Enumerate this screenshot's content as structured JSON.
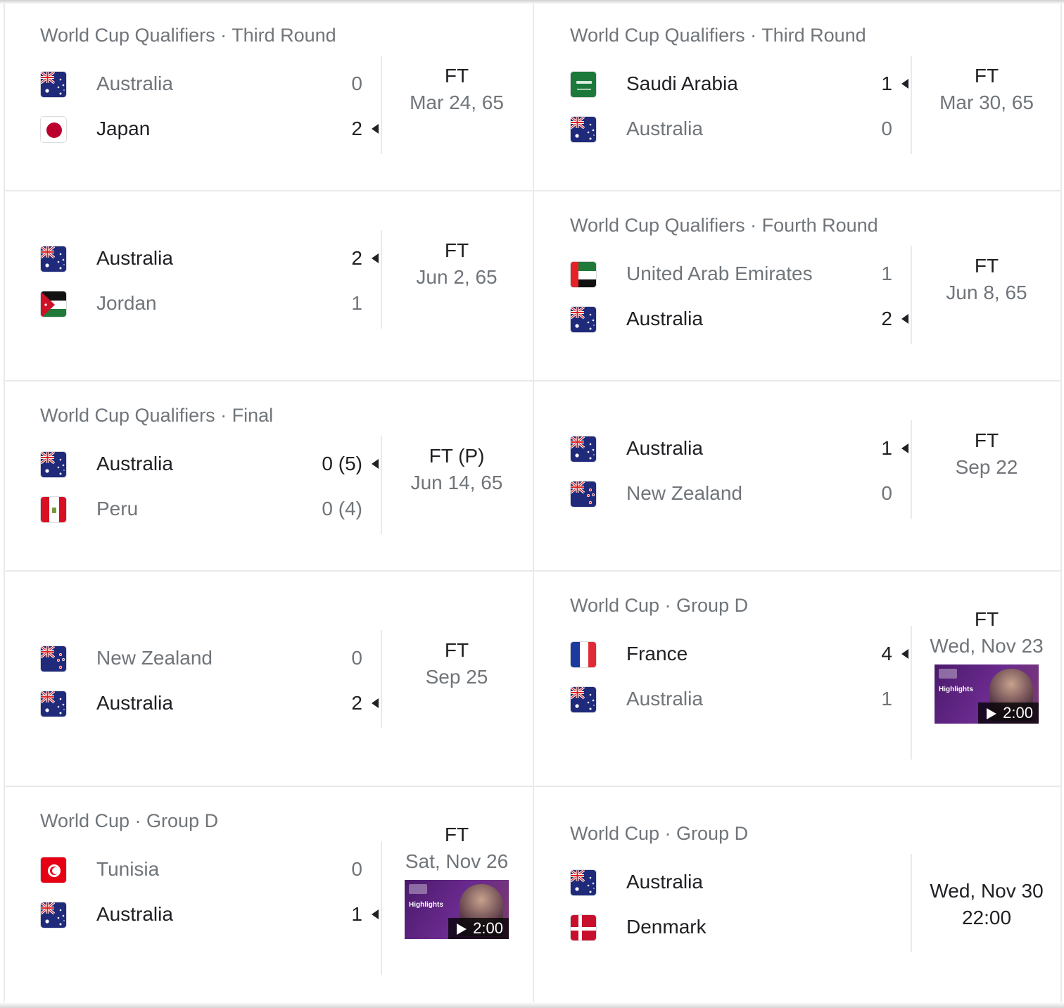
{
  "matches": [
    {
      "competition": "World Cup Qualifiers · Third Round",
      "team1": {
        "name": "Australia",
        "score": "0",
        "flag": "australia",
        "winner": false
      },
      "team2": {
        "name": "Japan",
        "score": "2",
        "flag": "japan",
        "winner": true
      },
      "status": "FT",
      "date": "Mar 24, 65"
    },
    {
      "competition": "World Cup Qualifiers · Third Round",
      "team1": {
        "name": "Saudi Arabia",
        "score": "1",
        "flag": "saudi-arabia",
        "winner": true
      },
      "team2": {
        "name": "Australia",
        "score": "0",
        "flag": "australia",
        "winner": false
      },
      "status": "FT",
      "date": "Mar 30, 65"
    },
    {
      "competition": "",
      "team1": {
        "name": "Australia",
        "score": "2",
        "flag": "australia",
        "winner": true
      },
      "team2": {
        "name": "Jordan",
        "score": "1",
        "flag": "jordan",
        "winner": false
      },
      "status": "FT",
      "date": "Jun 2, 65"
    },
    {
      "competition": "World Cup Qualifiers · Fourth Round",
      "team1": {
        "name": "United Arab Emirates",
        "score": "1",
        "flag": "uae",
        "winner": false
      },
      "team2": {
        "name": "Australia",
        "score": "2",
        "flag": "australia",
        "winner": true
      },
      "status": "FT",
      "date": "Jun 8, 65"
    },
    {
      "competition": "World Cup Qualifiers · Final",
      "team1": {
        "name": "Australia",
        "score": "0 (5)",
        "flag": "australia",
        "winner": true
      },
      "team2": {
        "name": "Peru",
        "score": "0 (4)",
        "flag": "peru",
        "winner": false
      },
      "status": "FT (P)",
      "date": "Jun 14, 65"
    },
    {
      "competition": "",
      "team1": {
        "name": "Australia",
        "score": "1",
        "flag": "australia",
        "winner": true
      },
      "team2": {
        "name": "New Zealand",
        "score": "0",
        "flag": "new-zealand",
        "winner": false
      },
      "status": "FT",
      "date": "Sep 22"
    },
    {
      "competition": "",
      "team1": {
        "name": "New Zealand",
        "score": "0",
        "flag": "new-zealand",
        "winner": false
      },
      "team2": {
        "name": "Australia",
        "score": "2",
        "flag": "australia",
        "winner": true
      },
      "status": "FT",
      "date": "Sep 25"
    },
    {
      "competition": "World Cup · Group D",
      "team1": {
        "name": "France",
        "score": "4",
        "flag": "france",
        "winner": true
      },
      "team2": {
        "name": "Australia",
        "score": "1",
        "flag": "australia",
        "winner": false
      },
      "status": "FT",
      "date": "Wed, Nov 23",
      "highlights": {
        "label": "Highlights",
        "duration": "2:00"
      }
    },
    {
      "competition": "World Cup · Group D",
      "team1": {
        "name": "Tunisia",
        "score": "0",
        "flag": "tunisia",
        "winner": false
      },
      "team2": {
        "name": "Australia",
        "score": "1",
        "flag": "australia",
        "winner": true
      },
      "status": "FT",
      "date": "Sat, Nov 26",
      "highlights": {
        "label": "Highlights",
        "duration": "2:00"
      }
    },
    {
      "competition": "World Cup · Group D",
      "team1": {
        "name": "Australia",
        "score": "",
        "flag": "australia",
        "winner": true
      },
      "team2": {
        "name": "Denmark",
        "score": "",
        "flag": "denmark",
        "winner": true
      },
      "status": "Wed, Nov 30",
      "date": "22:00",
      "upcoming": true
    }
  ]
}
